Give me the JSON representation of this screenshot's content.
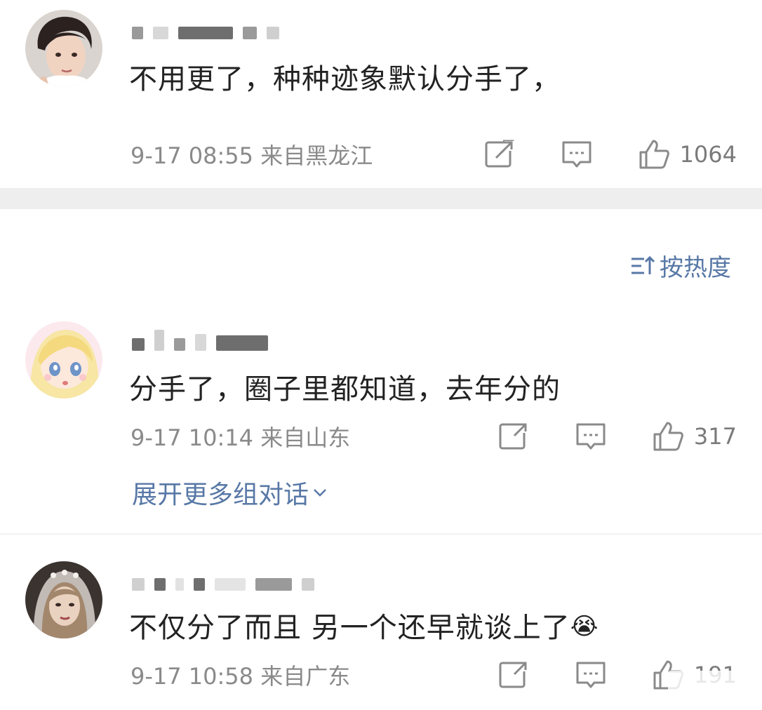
{
  "comments": [
    {
      "text": "不用更了，种种迹象默认分手了，",
      "time": "9-17 08:55 来自黑龙江",
      "likes": "1064",
      "avatar_icon": "male-avatar-icon"
    },
    {
      "text": "分手了，圈子里都知道，去年分的",
      "time": "9-17 10:14 来自山东",
      "likes": "317",
      "avatar_icon": "anime-girl-avatar-icon"
    },
    {
      "text": "不仅分了而且 另一个还早就谈上了",
      "emoji": "😭",
      "time": "9-17 10:58 来自广东",
      "likes": "191",
      "avatar_icon": "bride-avatar-icon"
    }
  ],
  "sort": {
    "label": "按热度"
  },
  "expand": {
    "label": "展开更多组对话"
  },
  "colors": {
    "link": "#5878a6",
    "meta": "#8a8a8a",
    "divider": "#eeeeee"
  }
}
